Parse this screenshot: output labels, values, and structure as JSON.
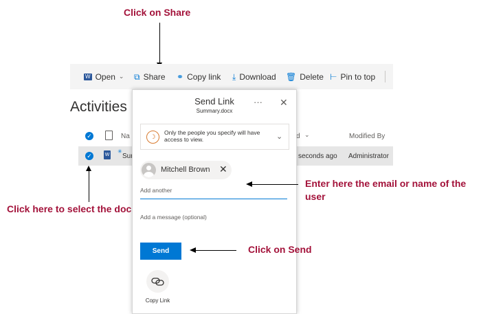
{
  "callouts": {
    "share": "Click on Share",
    "enter_user_line1": "Enter here the email or name of the",
    "enter_user_line2": "user",
    "send": "Click on Send",
    "select_doc": "Click here to select the document"
  },
  "toolbar": {
    "open": "Open",
    "share": "Share",
    "copy_link": "Copy link",
    "download": "Download",
    "delete": "Delete",
    "pin_to_top": "Pin to top"
  },
  "page": {
    "title": "Activities"
  },
  "list": {
    "columns": {
      "name_partial": "Na",
      "modified_partial": "d",
      "modified_by": "Modified By"
    },
    "row": {
      "name_partial": "Sur",
      "modified": "seconds ago",
      "modified_by": "Administrator"
    }
  },
  "dialog": {
    "title": "Send Link",
    "subtitle": "Summary.docx",
    "more": "···",
    "permission_text": "Only the people you specify will have access to view.",
    "recipient": "Mitchell Brown",
    "add_another_placeholder": "Add another",
    "message_placeholder": "Add a message (optional)",
    "send_label": "Send",
    "copy_link_label": "Copy Link"
  },
  "colors": {
    "accent": "#0078d4",
    "callout": "#a3123a",
    "toolbar_bg": "#f4f4f4"
  },
  "icons": {
    "open": "word-doc-icon",
    "share": "share-icon",
    "copy_link": "link-icon",
    "download": "download-icon",
    "delete": "trash-icon",
    "pin": "pin-icon"
  }
}
